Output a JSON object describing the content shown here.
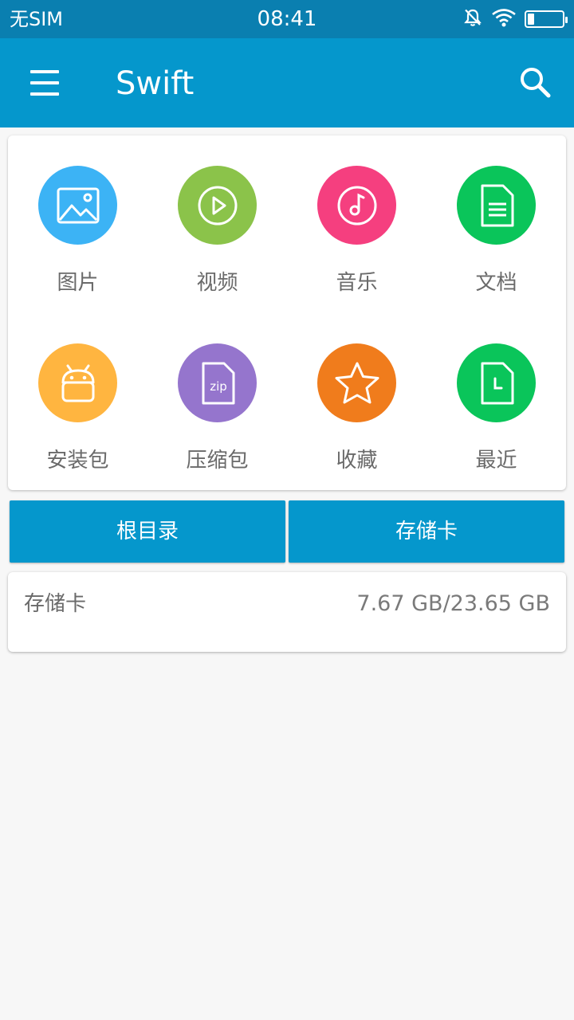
{
  "status_bar": {
    "carrier": "无SIM",
    "time": "08:41",
    "icons": [
      "bell-muted-icon",
      "wifi-icon",
      "battery-icon"
    ]
  },
  "app_bar": {
    "title": "Swift",
    "menu_icon": "hamburger-menu-icon",
    "search_icon": "search-icon",
    "color": "#0597cc"
  },
  "categories": [
    {
      "label": "图片",
      "icon": "image-icon",
      "color": "#3cb3f5"
    },
    {
      "label": "视频",
      "icon": "play-icon",
      "color": "#8bc34a"
    },
    {
      "label": "音乐",
      "icon": "music-note-icon",
      "color": "#f53f7f"
    },
    {
      "label": "文档",
      "icon": "document-icon",
      "color": "#0ac55a"
    },
    {
      "label": "安装包",
      "icon": "android-icon",
      "color": "#ffb540"
    },
    {
      "label": "压缩包",
      "icon": "zip-file-icon",
      "color": "#9575cd"
    },
    {
      "label": "收藏",
      "icon": "star-icon",
      "color": "#f07c1c"
    },
    {
      "label": "最近",
      "icon": "recent-file-icon",
      "color": "#0ac55a"
    }
  ],
  "zip_icon_text": "zip",
  "storage_buttons": {
    "root": "根目录",
    "sdcard": "存储卡"
  },
  "storage_info": {
    "label": "存储卡",
    "usage": "7.67 GB/23.65 GB"
  }
}
